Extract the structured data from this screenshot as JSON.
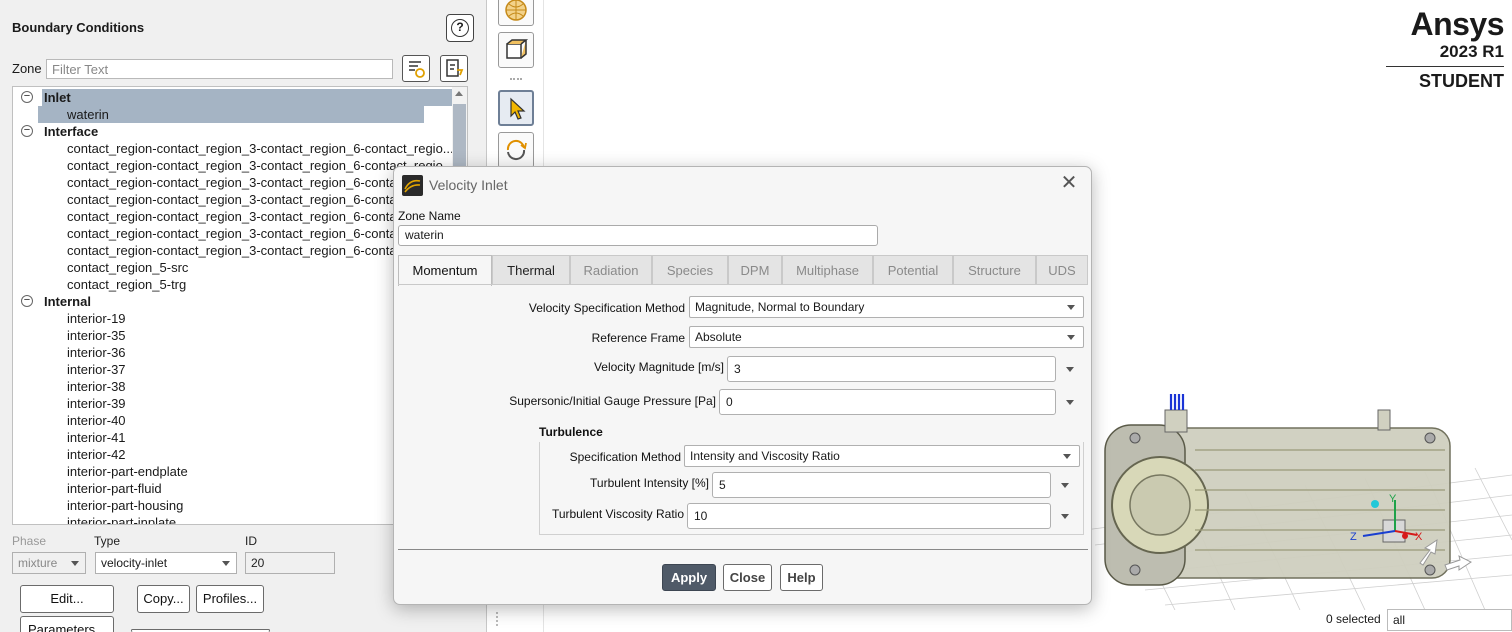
{
  "left_panel": {
    "title": "Boundary Conditions",
    "zone_label": "Zone",
    "filter_placeholder": "Filter Text",
    "tree": [
      {
        "type": "group",
        "label": "Inlet",
        "selected": true
      },
      {
        "type": "leaf",
        "label": "waterin",
        "selected": true
      },
      {
        "type": "group",
        "label": "Interface"
      },
      {
        "type": "leaf",
        "label": "contact_region-contact_region_3-contact_region_6-contact_regio..."
      },
      {
        "type": "leaf",
        "label": "contact_region-contact_region_3-contact_region_6-contact_regio..."
      },
      {
        "type": "leaf",
        "label": "contact_region-contact_region_3-contact_region_6-contact_regio..."
      },
      {
        "type": "leaf",
        "label": "contact_region-contact_region_3-contact_region_6-contact_regio..."
      },
      {
        "type": "leaf",
        "label": "contact_region-contact_region_3-contact_region_6-contact_regio..."
      },
      {
        "type": "leaf",
        "label": "contact_region-contact_region_3-contact_region_6-contact_regio..."
      },
      {
        "type": "leaf",
        "label": "contact_region-contact_region_3-contact_region_6-contact_regio..."
      },
      {
        "type": "leaf",
        "label": "contact_region_5-src"
      },
      {
        "type": "leaf",
        "label": "contact_region_5-trg"
      },
      {
        "type": "group",
        "label": "Internal"
      },
      {
        "type": "leaf",
        "label": "interior-19"
      },
      {
        "type": "leaf",
        "label": "interior-35"
      },
      {
        "type": "leaf",
        "label": "interior-36"
      },
      {
        "type": "leaf",
        "label": "interior-37"
      },
      {
        "type": "leaf",
        "label": "interior-38"
      },
      {
        "type": "leaf",
        "label": "interior-39"
      },
      {
        "type": "leaf",
        "label": "interior-40"
      },
      {
        "type": "leaf",
        "label": "interior-41"
      },
      {
        "type": "leaf",
        "label": "interior-42"
      },
      {
        "type": "leaf",
        "label": "interior-part-endplate"
      },
      {
        "type": "leaf",
        "label": "interior-part-fluid"
      },
      {
        "type": "leaf",
        "label": "interior-part-housing"
      },
      {
        "type": "leaf",
        "label": "interior-part-inplate"
      }
    ],
    "phase_label": "Phase",
    "phase_value": "mixture",
    "type_label": "Type",
    "type_value": "velocity-inlet",
    "id_label": "ID",
    "id_value": "20",
    "edit_label": "Edit...",
    "copy_label": "Copy...",
    "profiles_label": "Profiles...",
    "parameters_label": "Parameters..."
  },
  "graphics": {
    "brand_name": "Ansys",
    "brand_version": "2023 R1",
    "brand_edition": "STUDENT",
    "selected_count": "0 selected",
    "selection_filter": "all",
    "triad_labels": {
      "x": "X",
      "y": "Y",
      "z": "Z"
    }
  },
  "dialog": {
    "title": "Velocity Inlet",
    "zone_name_label": "Zone Name",
    "zone_name_value": "waterin",
    "tabs": [
      "Momentum",
      "Thermal",
      "Radiation",
      "Species",
      "DPM",
      "Multiphase",
      "Potential",
      "Structure",
      "UDS"
    ],
    "active_tab": "Momentum",
    "fields": {
      "velocity_spec_label": "Velocity Specification Method",
      "velocity_spec_value": "Magnitude, Normal to Boundary",
      "ref_frame_label": "Reference Frame",
      "ref_frame_value": "Absolute",
      "velocity_mag_label": "Velocity Magnitude [m/s]",
      "velocity_mag_value": "3",
      "pressure_label": "Supersonic/Initial Gauge Pressure [Pa]",
      "pressure_value": "0"
    },
    "turbulence": {
      "heading": "Turbulence",
      "spec_label": "Specification Method",
      "spec_value": "Intensity and Viscosity Ratio",
      "intensity_label": "Turbulent Intensity [%]",
      "intensity_value": "5",
      "viscosity_label": "Turbulent Viscosity Ratio",
      "viscosity_value": "10"
    },
    "buttons": {
      "apply": "Apply",
      "close": "Close",
      "help": "Help"
    }
  }
}
